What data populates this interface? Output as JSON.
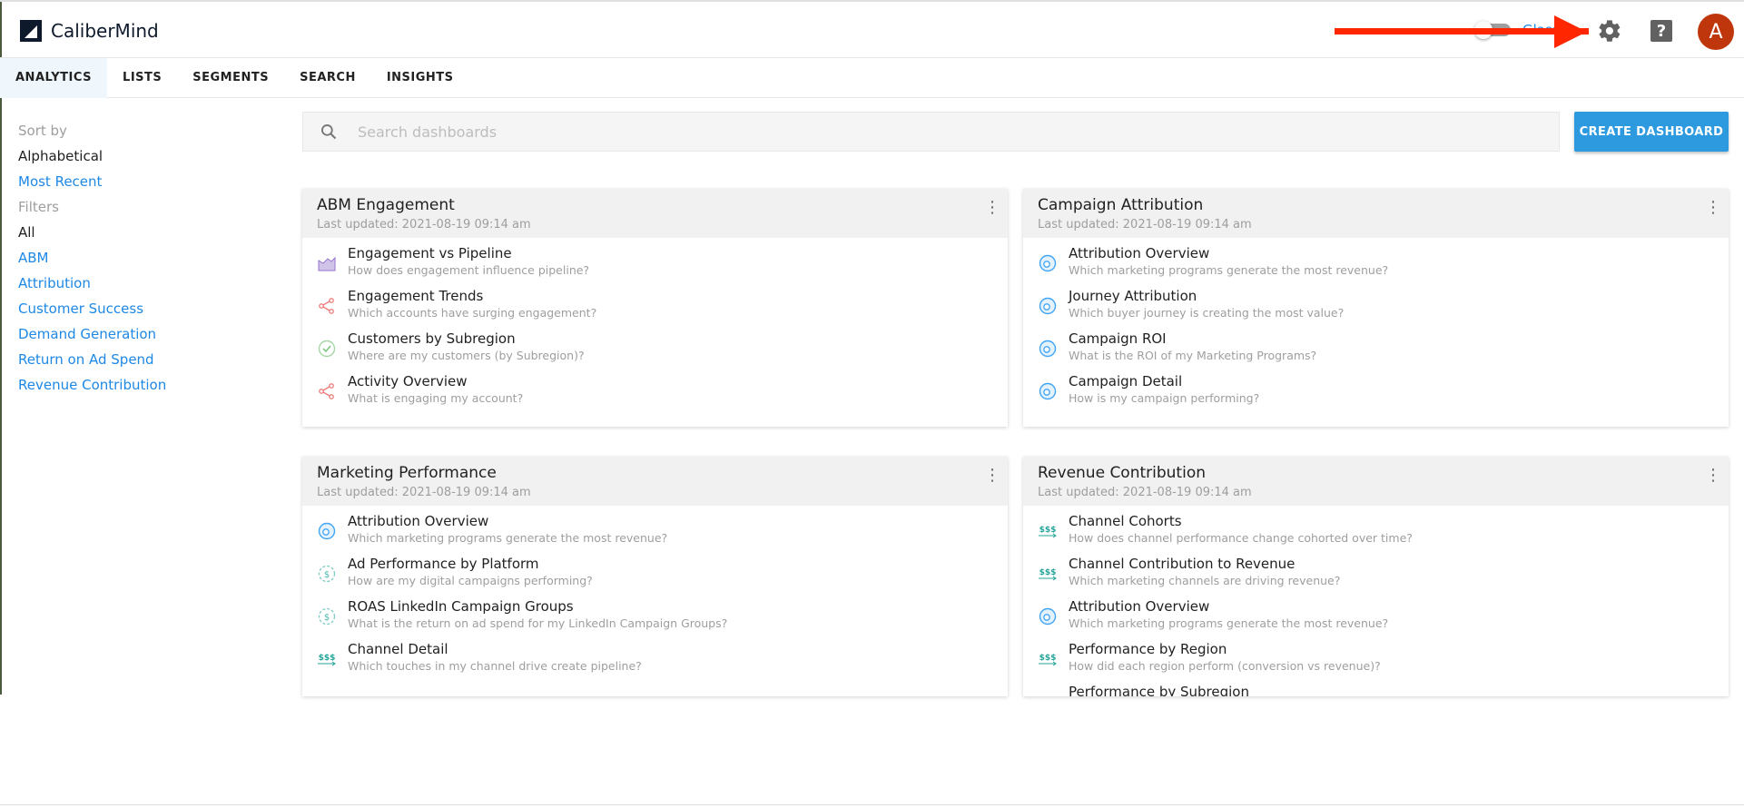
{
  "app": {
    "name": "CaliberMind",
    "toggle_label": "Glass",
    "avatar_initial": "A"
  },
  "nav": {
    "tabs": [
      "ANALYTICS",
      "LISTS",
      "SEGMENTS",
      "SEARCH",
      "INSIGHTS"
    ],
    "active": "ANALYTICS"
  },
  "sidebar": {
    "sort_heading": "Sort by",
    "sort_options": [
      "Alphabetical",
      "Most Recent"
    ],
    "selected_sort": "Alphabetical",
    "filter_heading": "Filters",
    "filters": [
      "All",
      "ABM",
      "Attribution",
      "Customer Success",
      "Demand Generation",
      "Return on Ad Spend",
      "Revenue Contribution"
    ],
    "selected_filter": "All"
  },
  "search": {
    "placeholder": "Search dashboards",
    "value": ""
  },
  "create_button": "CREATE DASHBOARD",
  "colors": {
    "accent": "#2d9ae0",
    "link": "#1e88e5",
    "avatar": "#bf360c",
    "annotation_arrow": "#ff2600"
  },
  "dashboards": [
    {
      "title": "ABM Engagement",
      "updated": "Last updated: 2021-08-19 09:14 am",
      "items": [
        {
          "icon": "area-chart-icon",
          "title": "Engagement vs Pipeline",
          "desc": "How does engagement influence pipeline?"
        },
        {
          "icon": "share-nodes-icon",
          "title": "Engagement Trends",
          "desc": "Which accounts have surging engagement?"
        },
        {
          "icon": "check-circle-icon",
          "title": "Customers by Subregion",
          "desc": "Where are my customers (by Subregion)?"
        },
        {
          "icon": "share-nodes-icon",
          "title": "Activity Overview",
          "desc": "What is engaging my account?"
        }
      ]
    },
    {
      "title": "Campaign Attribution",
      "updated": "Last updated: 2021-08-19 09:14 am",
      "items": [
        {
          "icon": "donut-chart-icon",
          "title": "Attribution Overview",
          "desc": "Which marketing programs generate the most revenue?"
        },
        {
          "icon": "donut-chart-icon",
          "title": "Journey Attribution",
          "desc": "Which buyer journey is creating the most value?"
        },
        {
          "icon": "donut-chart-icon",
          "title": "Campaign ROI",
          "desc": "What is the ROI of my Marketing Programs?"
        },
        {
          "icon": "donut-chart-icon",
          "title": "Campaign Detail",
          "desc": "How is my campaign performing?"
        }
      ]
    },
    {
      "title": "Marketing Performance",
      "updated": "Last updated: 2021-08-19 09:14 am",
      "items": [
        {
          "icon": "donut-chart-icon",
          "title": "Attribution Overview",
          "desc": "Which marketing programs generate the most revenue?"
        },
        {
          "icon": "dollar-cycle-icon",
          "title": "Ad Performance by Platform",
          "desc": "How are my digital campaigns performing?"
        },
        {
          "icon": "dollar-cycle-icon",
          "title": "ROAS LinkedIn Campaign Groups",
          "desc": "What is the return on ad spend for my LinkedIn Campaign Groups?"
        },
        {
          "icon": "money-flow-icon",
          "title": "Channel Detail",
          "desc": "Which touches in my channel drive create pipeline?"
        }
      ]
    },
    {
      "title": "Revenue Contribution",
      "updated": "Last updated: 2021-08-19 09:14 am",
      "items": [
        {
          "icon": "money-flow-icon",
          "title": "Channel Cohorts",
          "desc": "How does channel performance change cohorted over time?"
        },
        {
          "icon": "money-flow-icon",
          "title": "Channel Contribution to Revenue",
          "desc": "Which marketing channels are driving revenue?"
        },
        {
          "icon": "donut-chart-icon",
          "title": "Attribution Overview",
          "desc": "Which marketing programs generate the most revenue?"
        },
        {
          "icon": "money-flow-icon",
          "title": "Performance by Region",
          "desc": "How did each region perform (conversion vs revenue)?"
        },
        {
          "icon": "money-flow-icon",
          "title": "Performance by Subregion",
          "desc": ""
        }
      ]
    }
  ]
}
